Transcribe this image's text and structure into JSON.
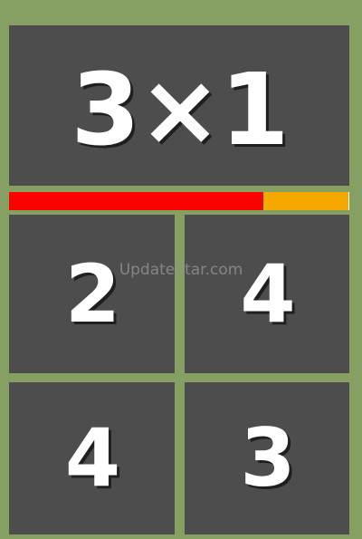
{
  "question": {
    "text": "3×1"
  },
  "timer": {
    "remaining_fraction": 0.75,
    "fill_color": "#ff0000",
    "track_color": "#f5a800"
  },
  "answers": [
    {
      "label": "2"
    },
    {
      "label": "4"
    },
    {
      "label": "4"
    },
    {
      "label": "3"
    }
  ],
  "watermark": {
    "text": "UpdateStar.com"
  },
  "colors": {
    "background": "#86a063",
    "panel": "#4d4d4d",
    "text": "#ffffff"
  }
}
